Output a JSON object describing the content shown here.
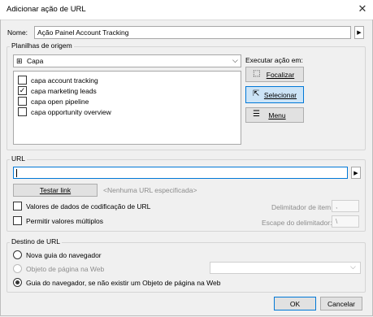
{
  "window": {
    "title": "Adicionar ação de URL"
  },
  "name_field": {
    "label": "Nome:",
    "value": "Ação Painel Account Tracking"
  },
  "source_sheets": {
    "group_label": "Planilhas de origem",
    "dropdown_value": "Capa",
    "items": [
      {
        "label": "capa account tracking",
        "checked": false
      },
      {
        "label": "capa marketing leads",
        "checked": true
      },
      {
        "label": "capa open pipeline",
        "checked": false
      },
      {
        "label": "capa opportunity overview",
        "checked": false
      }
    ]
  },
  "run_action": {
    "label": "Executar ação em:",
    "buttons": [
      {
        "label": "Focalizar",
        "icon": "hover-cursor-icon",
        "selected": false
      },
      {
        "label": "Selecionar",
        "icon": "select-cursor-icon",
        "selected": true
      },
      {
        "label": "Menu",
        "icon": "menu-cursor-icon",
        "selected": false
      }
    ]
  },
  "url": {
    "group_label": "URL",
    "value": "",
    "test_button": "Testar link",
    "placeholder_note": "<Nenhuma URL especificada>",
    "encode_checkbox": "Valores de dados de codificação de URL",
    "multi_checkbox": "Permitir valores múltiplos",
    "item_delimiter_label": "Delimitador de item:",
    "item_delimiter_value": ",",
    "escape_label": "Escape do delimitador:",
    "escape_value": "\\"
  },
  "destination": {
    "group_label": "Destino de URL",
    "options": [
      {
        "label": "Nova guia do navegador",
        "selected": false,
        "disabled": false
      },
      {
        "label": "Objeto de página na Web",
        "selected": false,
        "disabled": true
      },
      {
        "label": "Guia do navegador, se não existir um Objeto de página na Web",
        "selected": true,
        "disabled": false
      }
    ],
    "web_object_dropdown": ""
  },
  "footer": {
    "ok": "OK",
    "cancel": "Cancelar"
  }
}
